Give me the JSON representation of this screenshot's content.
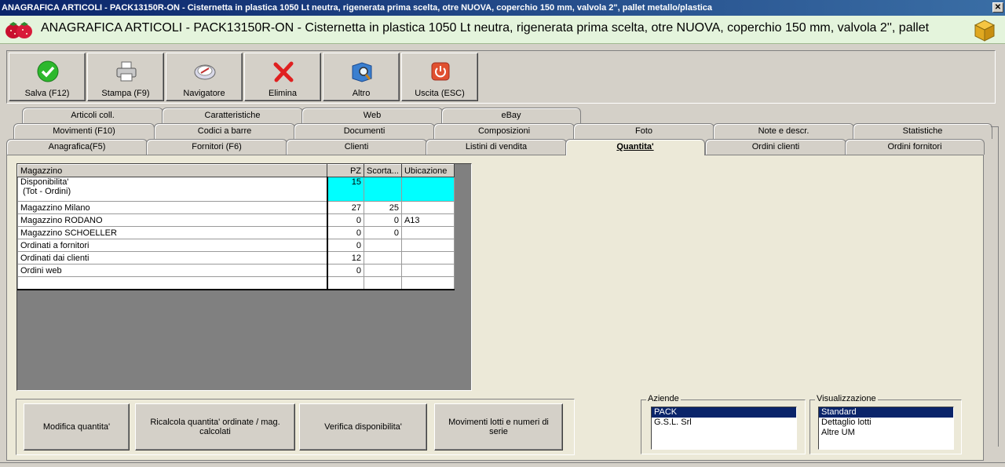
{
  "window": {
    "title": "ANAGRAFICA ARTICOLI - PACK13150R-ON - Cisternetta in plastica 1050 Lt neutra, rigenerata prima scelta, otre NUOVA, coperchio 150 mm, valvola 2\", pallet metallo/plastica",
    "close_label": "✕"
  },
  "header": {
    "title": "ANAGRAFICA ARTICOLI - PACK13150R-ON - Cisternetta in plastica 1050 Lt neutra, rigenerata prima scelta, otre NUOVA, coperchio 150 mm, valvola 2'', pallet"
  },
  "toolbar": {
    "save_label": "Salva (F12)",
    "print_label": "Stampa (F9)",
    "navigator_label": "Navigatore",
    "delete_label": "Elimina",
    "other_label": "Altro",
    "exit_label": "Uscita (ESC)"
  },
  "tabs": {
    "row1": [
      "Articoli coll.",
      "Caratteristiche",
      "Web",
      "eBay"
    ],
    "row2": [
      "Movimenti (F10)",
      "Codici a barre",
      "Documenti",
      "Composizioni",
      "Foto",
      "Note e descr.",
      "Statistiche"
    ],
    "row3": [
      "Anagrafica(F5)",
      "Fornitori (F6)",
      "Clienti",
      "Listini di vendita",
      "Quantita'",
      "Ordini clienti",
      "Ordini fornitori"
    ]
  },
  "grid": {
    "headers": [
      "Magazzino",
      "PZ",
      "Scorta...",
      "Ubicazione"
    ],
    "rows": [
      {
        "name_line1": "Disponibilita'",
        "name_line2": "(Tot - Ordini)",
        "pz": "15",
        "scorta": "",
        "ubicazione": ""
      },
      {
        "name": "Magazzino Milano",
        "pz": "27",
        "scorta": "25",
        "ubicazione": ""
      },
      {
        "name": "Magazzino RODANO",
        "pz": "0",
        "scorta": "0",
        "ubicazione": "A13"
      },
      {
        "name": "Magazzino SCHOELLER",
        "pz": "0",
        "scorta": "0",
        "ubicazione": ""
      },
      {
        "name": "Ordinati a fornitori",
        "pz": "0",
        "scorta": "",
        "ubicazione": ""
      },
      {
        "name": "Ordinati dai clienti",
        "pz": "12",
        "scorta": "",
        "ubicazione": ""
      },
      {
        "name": "Ordini web",
        "pz": "0",
        "scorta": "",
        "ubicazione": ""
      },
      {
        "name": "",
        "pz": "",
        "scorta": "",
        "ubicazione": ""
      }
    ]
  },
  "actions": {
    "modify_label": "Modifica quantita'",
    "recalc_label": "Ricalcola quantita' ordinate / mag. calcolati",
    "verify_label": "Verifica disponibilita'",
    "lots_label": "Movimenti lotti e numeri di serie"
  },
  "aziende": {
    "label": "Aziende",
    "items": [
      "PACK",
      "G.S.L. Srl"
    ],
    "selected": "PACK"
  },
  "visualizzazione": {
    "label": "Visualizzazione",
    "items": [
      "Standard",
      "Dettaglio lotti",
      "Altre UM"
    ],
    "selected": "Standard"
  },
  "colors": {
    "titlebar": "#0a246a",
    "header_bg": "#e4f4dc",
    "availability_highlight": "#00ffff",
    "selection": "#0a246a"
  }
}
